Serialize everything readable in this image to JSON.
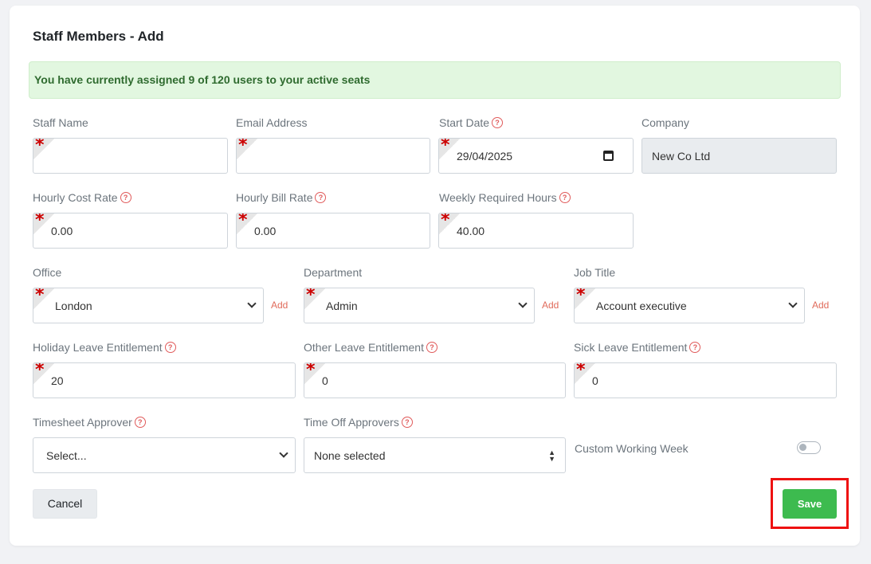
{
  "page": {
    "title": "Staff Members - Add"
  },
  "alert": {
    "message": "You have currently assigned 9 of 120 users to your active seats"
  },
  "fields": {
    "staff_name": {
      "label": "Staff Name",
      "value": ""
    },
    "email": {
      "label": "Email Address",
      "value": ""
    },
    "start_date": {
      "label": "Start Date",
      "value": "29/04/2025"
    },
    "company": {
      "label": "Company",
      "value": "New Co Ltd"
    },
    "hourly_cost_rate": {
      "label": "Hourly Cost Rate",
      "value": "0.00"
    },
    "hourly_bill_rate": {
      "label": "Hourly Bill Rate",
      "value": "0.00"
    },
    "weekly_required_hours": {
      "label": "Weekly Required Hours",
      "value": "40.00"
    },
    "office": {
      "label": "Office",
      "value": "London",
      "add_label": "Add"
    },
    "department": {
      "label": "Department",
      "value": "Admin",
      "add_label": "Add"
    },
    "job_title": {
      "label": "Job Title",
      "value": "Account executive",
      "add_label": "Add"
    },
    "holiday_leave": {
      "label": "Holiday Leave Entitlement",
      "value": "20"
    },
    "other_leave": {
      "label": "Other Leave Entitlement",
      "value": "0"
    },
    "sick_leave": {
      "label": "Sick Leave Entitlement",
      "value": "0"
    },
    "timesheet_approver": {
      "label": "Timesheet Approver",
      "value": "Select..."
    },
    "time_off_approvers": {
      "label": "Time Off Approvers",
      "value": "None selected"
    },
    "custom_working_week": {
      "label": "Custom Working Week",
      "enabled": false
    }
  },
  "required_marker": "*",
  "help_glyph": "?",
  "buttons": {
    "cancel": "Cancel",
    "save": "Save"
  },
  "colors": {
    "save": "#3dbb4f",
    "alert_bg": "#e2f7e0",
    "alert_text": "#2f6b2f",
    "required": "#cc0000",
    "highlight": "#ee1111",
    "help": "#e05a5a"
  },
  "icons": {
    "help": "question-circle-icon",
    "dropdown": "chevron-down-icon",
    "calendar": "calendar-icon",
    "sort": "sort-icon"
  }
}
